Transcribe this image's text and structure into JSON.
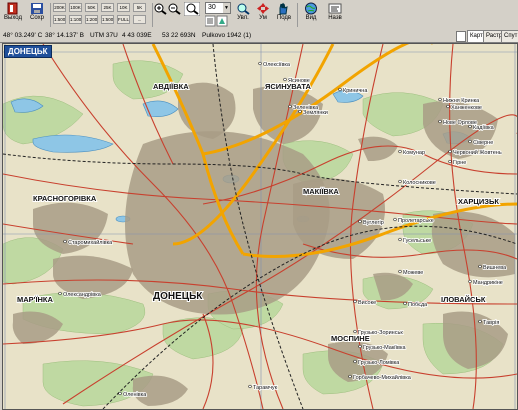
{
  "toolbar": {
    "exit_label": "Выход",
    "save_label": "Сохр",
    "small_buttons": [
      "200K",
      "100K",
      "50K",
      "25K",
      "10K",
      "5K",
      "1:500",
      "1:1000",
      "1:2000",
      "1:5000",
      "FULL",
      "..."
    ],
    "group_labels": [
      "Увл.",
      "Ум",
      "Подв",
      "Вид",
      "Назв"
    ],
    "ribbon_labels": [
      "М",
      "1",
      "2",
      "3",
      "4",
      "5",
      "6",
      "7",
      "8"
    ],
    "zoom_value": "30"
  },
  "status": {
    "lat": "48° 03.249' С",
    "lon": "38° 14.137' В",
    "utm": "UTM  37U",
    "easting": "4 43 039E",
    "northing": "53 22 693N",
    "datum": "Pulkovo 1942 (1)"
  },
  "tabs": [
    "Карта",
    "Растр",
    "Спут"
  ],
  "map": {
    "region_label": "ДОНЕЦЬК",
    "colors": {
      "base": "#e8e2c8",
      "urban": "#a89c86",
      "forest": "#bfd9a2",
      "water": "#8ec6e6",
      "highway": "#f2a400",
      "road": "#c8402e",
      "rail": "#222222"
    },
    "cities": [
      {
        "name": "АВДІЇВКА",
        "size": "big"
      },
      {
        "name": "ЯСИНУВАТА",
        "size": "big"
      },
      {
        "name": "МАКІЇВКА",
        "size": "big"
      },
      {
        "name": "КРАСНОГОРІВКА",
        "size": "big"
      },
      {
        "name": "ДОНЕЦЬК",
        "size": "huge"
      },
      {
        "name": "МАР'ЇНКА",
        "size": "big"
      },
      {
        "name": "МОСПИНЕ",
        "size": "big"
      },
      {
        "name": "ХАРЦИЗЬК",
        "size": "big"
      },
      {
        "name": "ІЛОВАЙСЬК",
        "size": "big"
      }
    ],
    "towns": [
      "Ясинове",
      "Кринична",
      "Зеленівка",
      "Нижня Кринка",
      "Ханженкове",
      "Нове Орлове",
      "Колосникове",
      "Старомихайлівка",
      "Олександрівка",
      "Вуглегір",
      "Пролетарське",
      "Гусельське",
      "Грузько-Зоринськ",
      "Грузько-Ломівка",
      "Горбачево-Михайлівка",
      "Оленівка",
      "Тарамчук",
      "Мандрикіне",
      "Вишнева",
      "Сіверне",
      "Високе",
      "Можеве",
      "Побєда",
      "Грузько-Макіївка",
      "Таврія",
      "Землянки",
      "Гірне",
      "Комунар",
      "Олексіївка",
      "Червоний Жовтень",
      "Кадіївка"
    ]
  }
}
